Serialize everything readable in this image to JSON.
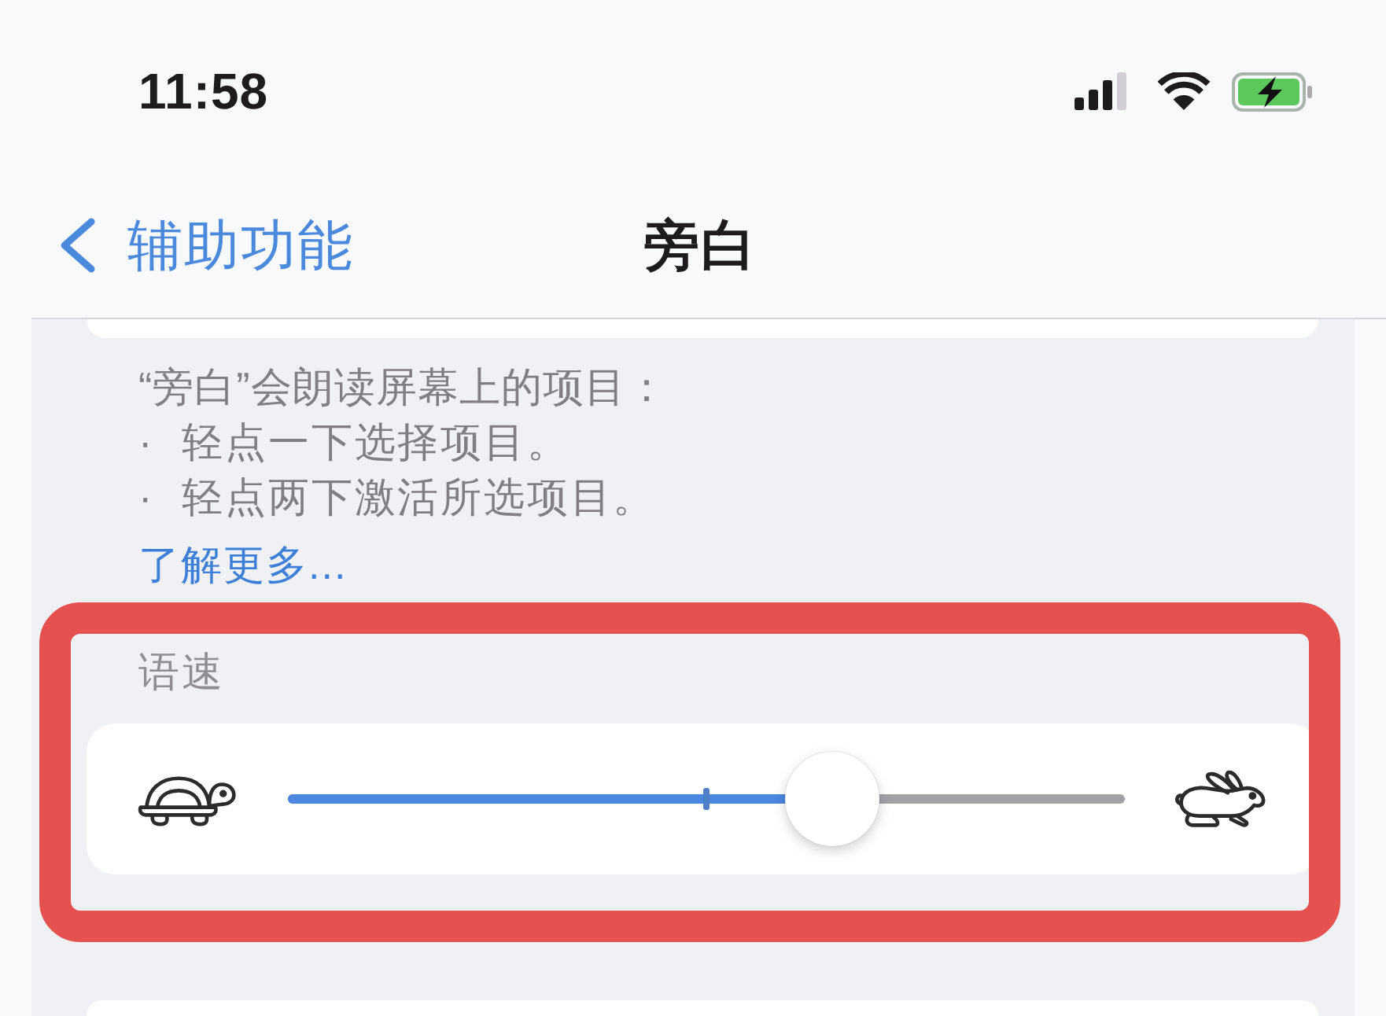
{
  "status_bar": {
    "time": "11:58"
  },
  "nav_bar": {
    "back_label": "辅助功能",
    "title": "旁白"
  },
  "description": {
    "intro": "“旁白”会朗读屏幕上的项目：",
    "bullets": [
      "· 轻点一下选择项目。",
      "· 轻点两下激活所选项目。"
    ],
    "link": "了解更多..."
  },
  "speaking_rate": {
    "header": "语速",
    "level": 0.65,
    "highlighted": true
  }
}
